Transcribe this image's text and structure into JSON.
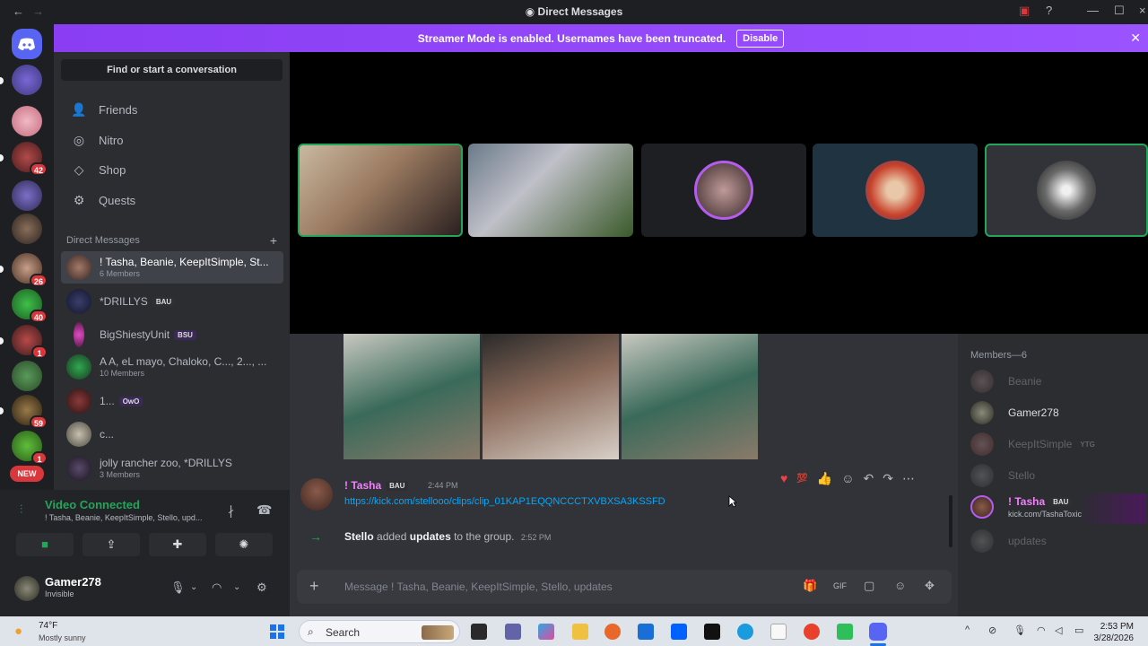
{
  "window": {
    "title": "Direct Messages"
  },
  "banner": {
    "text": "Streamer Mode is enabled. Usernames have been truncated.",
    "button": "Disable"
  },
  "sidebar": {
    "find_conversation": "Find or start a conversation",
    "nav": [
      {
        "label": "Friends",
        "icon": "friends-icon"
      },
      {
        "label": "Nitro",
        "icon": "nitro-icon"
      },
      {
        "label": "Shop",
        "icon": "shop-icon"
      },
      {
        "label": "Quests",
        "icon": "quests-icon"
      }
    ],
    "dm_header": "Direct Messages",
    "dms": [
      {
        "name": "! Tasha, Beanie, KeepItSimple, St...",
        "sub": "6 Members"
      },
      {
        "name": "*DRILLYS",
        "tag": "BAU"
      },
      {
        "name": "BigShiestyUnit",
        "tag": "BSU"
      },
      {
        "name": "A A, eL mayo, Chaloko, C..., 2..., ...",
        "sub": "10 Members"
      },
      {
        "name": "1...",
        "tag": "OwO"
      },
      {
        "name": "c..."
      },
      {
        "name": "jolly rancher zoo, *DRILLYS",
        "sub": "3 Members"
      }
    ]
  },
  "rail": {
    "badges": [
      "42",
      "26",
      "40",
      "1",
      "59",
      "1"
    ],
    "new_label": "NEW"
  },
  "voice": {
    "title": "Video Connected",
    "sub": "! Tasha, Beanie, KeepItSimple, Stello, upd..."
  },
  "user": {
    "name": "Gamer278",
    "status": "Invisible"
  },
  "chat": {
    "message": {
      "author": "! Tasha",
      "tag": "BAU",
      "time": "2:44 PM",
      "link": "https://kick.com/stellooo/clips/clip_01KAP1EQQNCCCTXVBXSA3KSSFD"
    },
    "system": {
      "actor": "Stello",
      "verb": "added",
      "target": "updates",
      "suffix": "to the group.",
      "time": "2:52 PM"
    },
    "composer_placeholder": "Message ! Tasha, Beanie, KeepItSimple, Stello, updates"
  },
  "members": {
    "header": "Members—6",
    "list": [
      {
        "name": "Beanie",
        "dim": true
      },
      {
        "name": "Gamer278",
        "dim": false
      },
      {
        "name": "KeepItSimple",
        "tag": "YTG",
        "dim": true
      },
      {
        "name": "Stello",
        "dim": true
      },
      {
        "name": "! Tasha",
        "tag": "BAU",
        "sub": "kick.com/TashaToxic",
        "dim": false
      },
      {
        "name": "updates",
        "dim": true
      }
    ]
  },
  "taskbar": {
    "weather_temp": "74°F",
    "weather_desc": "Mostly sunny",
    "search": "Search",
    "time": "2:53 PM",
    "date": "3/28/2026"
  },
  "colors": {
    "accent": "#5865f2",
    "streamer": "#8d47f7",
    "online": "#23a55a",
    "link": "#00a8fc",
    "tasha": "#f47fff"
  }
}
